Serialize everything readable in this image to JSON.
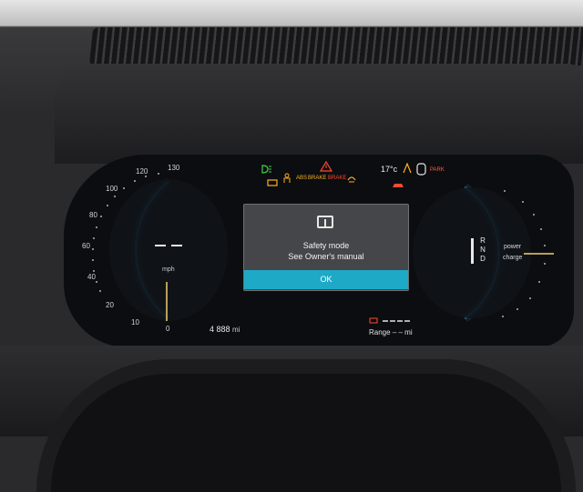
{
  "speedometer": {
    "ticks": [
      "0",
      "10",
      "20",
      "40",
      "60",
      "80",
      "100",
      "120",
      "130"
    ],
    "unit": "mph",
    "speed": "– –"
  },
  "odometer": {
    "value": "4 888",
    "unit": "mi"
  },
  "range": {
    "label": "Range",
    "value": "– –",
    "unit": "mi"
  },
  "telltales": {
    "abs": "ABS",
    "brake1": "BRAKE",
    "brake2": "BRAKE",
    "temperature": "17°c",
    "park": "PARK"
  },
  "popup": {
    "title": "Safety mode",
    "message": "See Owner's manual",
    "ok_label": "OK"
  },
  "gear": {
    "items": [
      "R",
      "N",
      "D"
    ]
  },
  "power_meter": {
    "power_label": "power",
    "charge_label": "charge"
  },
  "colors": {
    "gauge_ring": "#2f9fd6",
    "ok_button": "#1ea9c7",
    "warning": "#ffb020",
    "alert": "#ff4a30",
    "indicator_green": "#3ecf4a"
  }
}
